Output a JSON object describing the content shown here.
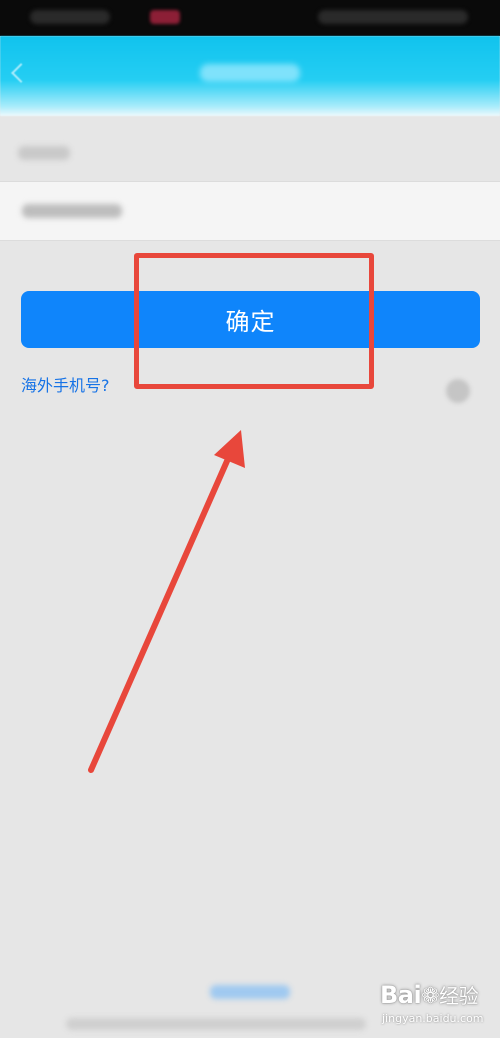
{
  "main": {
    "confirm_label": "确定",
    "overseas_link": "海外手机号?"
  },
  "watermark": {
    "brand_prefix": "Bai",
    "brand_suffix": "经验",
    "url": "jingyan.baidu.com"
  },
  "colors": {
    "header": "#25cef3",
    "confirm_button": "#0f85fb",
    "link": "#1773e6",
    "annotation": "#e8473b",
    "background": "#e6e6e6"
  },
  "icons": [
    "back-arrow-icon",
    "clear-input-icon",
    "paw-icon"
  ]
}
